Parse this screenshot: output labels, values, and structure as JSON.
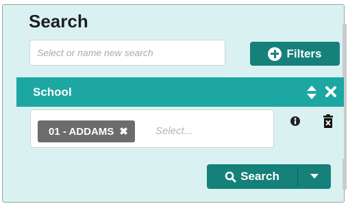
{
  "header": {
    "title": "Search"
  },
  "search_name": {
    "placeholder": "Select or name new search"
  },
  "filters_button": {
    "label": "Filters"
  },
  "school_section": {
    "title": "School",
    "selected_chip": "01 - ADDAMS",
    "select_placeholder": "Select..."
  },
  "search_button": {
    "label": "Search"
  },
  "colors": {
    "accent": "#16807a",
    "section_header": "#1ca7a2",
    "panel_bg": "#d9f1f1",
    "chip_bg": "#6c6c6c"
  }
}
